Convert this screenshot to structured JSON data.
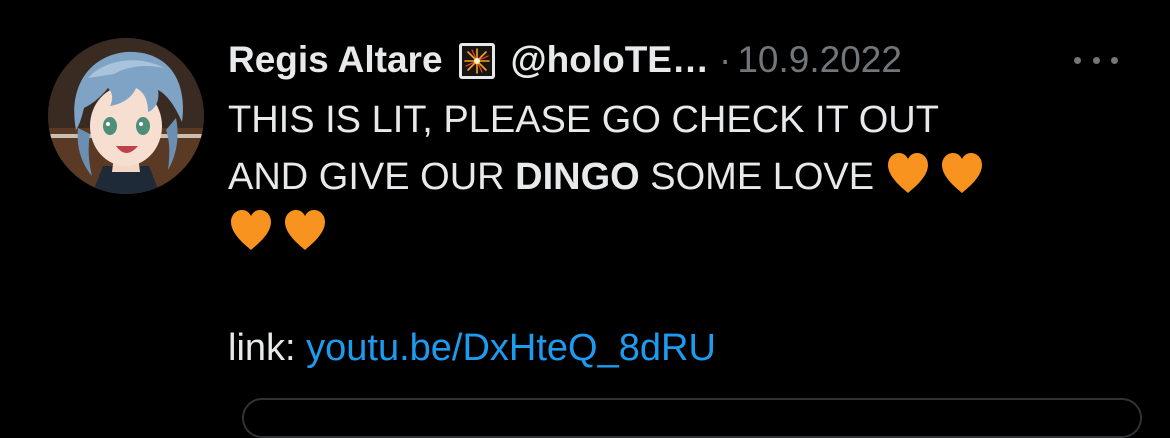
{
  "tweet": {
    "author": {
      "display_name": "Regis Altare",
      "badge_icon": "fireworks-emoji",
      "handle": "@holoTE…"
    },
    "separator": "·",
    "date": "10.9.2022",
    "more_icon": "more-horizontal-icon",
    "text": {
      "line1": "THIS IS LIT, PLEASE GO CHECK IT OUT",
      "line2_before": "AND GIVE OUR ",
      "line2_bold": "DINGO",
      "line2_after": " SOME LOVE ",
      "heart_icon": "orange-heart-emoji",
      "heart_color": "#f7931e",
      "link_label": "link: ",
      "link_text": "youtu.be/DxHteQ_8dRU"
    }
  },
  "colors": {
    "background": "#000000",
    "text_primary": "#e7e9ea",
    "text_secondary": "#71767b",
    "link": "#1d9bf0"
  }
}
